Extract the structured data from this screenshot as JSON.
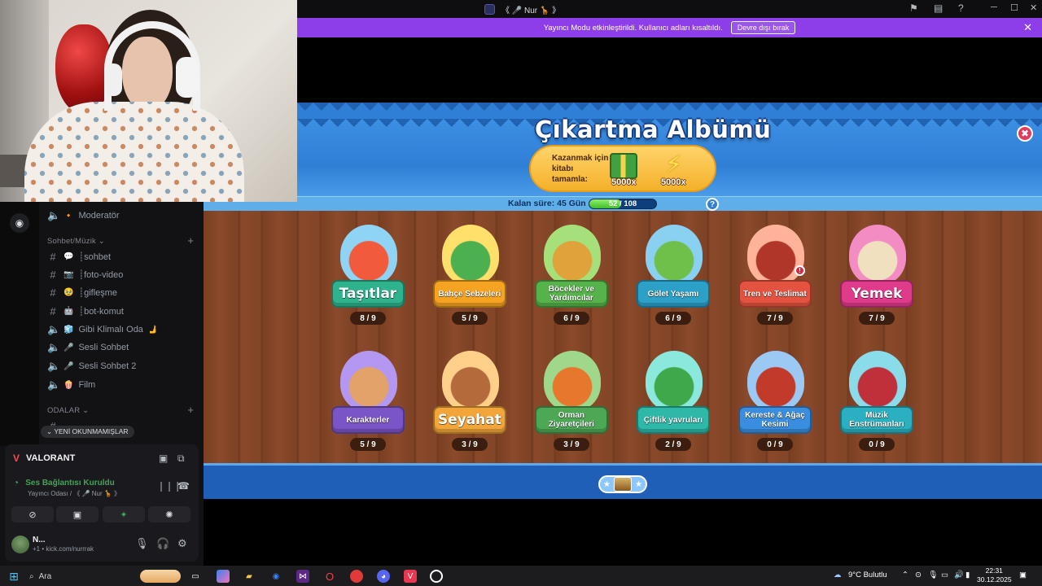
{
  "discord": {
    "channels": [
      {
        "sym": "🔈",
        "label": "Moderatör",
        "emoji": "🔸"
      },
      {
        "sym": "#",
        "label": "┊sohbet",
        "emoji": "💬"
      },
      {
        "sym": "#",
        "label": "┊foto-video",
        "emoji": "📷"
      },
      {
        "sym": "#",
        "label": "┊gifleşme",
        "emoji": "🥹"
      },
      {
        "sym": "#",
        "label": "┊bot-komut",
        "emoji": "🤖"
      },
      {
        "sym": "🔈",
        "label": "Gibi Klimalı Oda",
        "emoji": "🧊",
        "suffix": "🫸"
      },
      {
        "sym": "🔈",
        "label": "Sesli Sohbet",
        "emoji": "🎤"
      },
      {
        "sym": "🔈",
        "label": "Sesli Sohbet 2",
        "emoji": "🎤"
      },
      {
        "sym": "🔈",
        "label": "Film",
        "emoji": "🍿"
      }
    ],
    "category_music": "Sohbet/Müzik",
    "category_rooms": "ODALAR",
    "unread_pill": "YENİ OKUNMAMIŞLAR",
    "voice": {
      "game": "VALORANT",
      "status": "Ses Bağlantısı Kuruldu",
      "room": "Yayıncı Odası / 《 🎤 Nur 🦒 》"
    },
    "user": {
      "name": "N...",
      "sub": "+1 • kick.com/nurrrak"
    }
  },
  "titlebar": {
    "title": "《 🎤 Nur 🦒 》"
  },
  "notice": {
    "text": "Yayıncı Modu etkinleştirildi. Kullanıcı adları kısaltıldı.",
    "button": "Devre dışı bırak"
  },
  "game": {
    "title": "Çıkartma Albümü",
    "reward_text": "Kazanmak için kitabı tamamla:",
    "reward_gift": "5000x",
    "reward_energy": "5000x",
    "time_left": "Kalan süre: 45 Gün",
    "progress_label": "52 / 108",
    "progress_value": 52,
    "progress_max": 108,
    "help": "?",
    "close": "✖",
    "stickers": [
      {
        "name": "Taşıtlar",
        "count": "8 / 9",
        "size": "big",
        "color": "#2fb38e",
        "art": "#f15a3a",
        "bg": "#8fd3f5"
      },
      {
        "name": "Bahçe Sebzeleri",
        "count": "5 / 9",
        "size": "small",
        "color": "#f6a321",
        "art": "#4caf50",
        "bg": "#ffe06a"
      },
      {
        "name": "Böcekler ve Yardımcılar",
        "count": "6 / 9",
        "size": "small",
        "color": "#56b24a",
        "art": "#e0a23a",
        "bg": "#a6e07a"
      },
      {
        "name": "Gölet Yaşamı",
        "count": "6 / 9",
        "size": "small",
        "color": "#2da0c8",
        "art": "#6fc04a",
        "bg": "#8ad0f0"
      },
      {
        "name": "Tren ve Teslimat",
        "count": "7 / 9",
        "size": "small",
        "color": "#e3533f",
        "art": "#b0362a",
        "bg": "#ffb39a",
        "alert": "!"
      },
      {
        "name": "Yemek",
        "count": "7 / 9",
        "size": "big",
        "color": "#e03a8a",
        "art": "#f0e0c0",
        "bg": "#f48cc4"
      },
      {
        "name": "Karakterler",
        "count": "5 / 9",
        "size": "small",
        "color": "#7a55c8",
        "art": "#e2a26a",
        "bg": "#b497f0"
      },
      {
        "name": "Seyahat",
        "count": "3 / 9",
        "size": "big",
        "color": "#f2a63a",
        "art": "#b46a3a",
        "bg": "#ffd08a"
      },
      {
        "name": "Orman Ziyaretçileri",
        "count": "3 / 9",
        "size": "small",
        "color": "#4da856",
        "art": "#e8772e",
        "bg": "#9fd88a"
      },
      {
        "name": "Çiftlik yavruları",
        "count": "2 / 9",
        "size": "small",
        "color": "#2db8a8",
        "art": "#3fa84a",
        "bg": "#8ae8dc"
      },
      {
        "name": "Kereste & Ağaç Kesimi",
        "count": "0 / 9",
        "size": "small",
        "color": "#3a8ee0",
        "art": "#c23a2a",
        "bg": "#9cc8f4"
      },
      {
        "name": "Müzik Enstrümanları",
        "count": "0 / 9",
        "size": "small",
        "color": "#2ab0c0",
        "art": "#c0303a",
        "bg": "#8adcea"
      }
    ]
  },
  "taskbar": {
    "search_label": "Ara",
    "weather": "9°C  Bulutlu",
    "time": "22:31",
    "date": "30.12.2025"
  }
}
